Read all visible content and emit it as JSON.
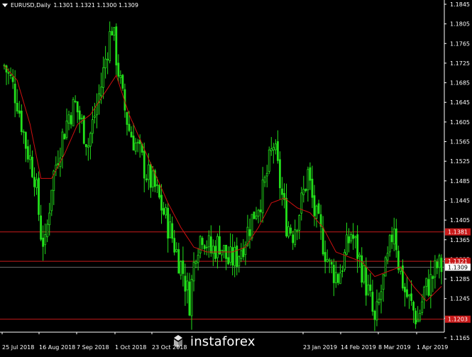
{
  "chart_header": {
    "symbol_timeframe": "EURUSD,Daily",
    "ohlc": "1.1301 1.1321 1.1300 1.1309"
  },
  "watermark": {
    "text": "instaforex"
  },
  "colors": {
    "background": "#000000",
    "candle": "#22e01b",
    "moving_average": "#d01010",
    "level_line": "#c81a1a",
    "price_tag_red": "#c81a1a",
    "price_tag_current": "#ffffff",
    "axis_text": "#ffffff"
  },
  "chart_data": {
    "type": "candlestick",
    "symbol": "EURUSD",
    "timeframe": "Daily",
    "ylim": [
      1.1165,
      1.1855
    ],
    "y_ticks": [
      "1.1845",
      "1.1805",
      "1.1765",
      "1.1725",
      "1.1685",
      "1.1645",
      "1.1605",
      "1.1565",
      "1.1525",
      "1.1485",
      "1.1445",
      "1.1405",
      "1.1365",
      "1.1325",
      "1.1285",
      "1.1245",
      "1.1205",
      "1.1165"
    ],
    "x_tick_labels": [
      "25 Jul 2018",
      "16 Aug 2018",
      "7 Sep 2018",
      "1 Oct 2018",
      "23 Oct 2018",
      "23 Jan 2019",
      "14 Feb 2019",
      "8 Mar 2019",
      "1 Apr 2019"
    ],
    "horizontal_levels": [
      {
        "label": "1.1381",
        "value": 1.1381
      },
      {
        "label": "1.1321",
        "value": 1.1321
      },
      {
        "label": "1.1203",
        "value": 1.1203
      }
    ],
    "current_price": {
      "label": "1.1309",
      "value": 1.1309
    },
    "close_path": [
      [
        0,
        1.172
      ],
      [
        3,
        1.169
      ],
      [
        6,
        1.165
      ],
      [
        10,
        1.156
      ],
      [
        14,
        1.15
      ],
      [
        17,
        1.138
      ],
      [
        19,
        1.135
      ],
      [
        22,
        1.148
      ],
      [
        26,
        1.156
      ],
      [
        30,
        1.162
      ],
      [
        33,
        1.164
      ],
      [
        36,
        1.16
      ],
      [
        39,
        1.156
      ],
      [
        42,
        1.162
      ],
      [
        45,
        1.168
      ],
      [
        48,
        1.176
      ],
      [
        50,
        1.18
      ],
      [
        52,
        1.174
      ],
      [
        55,
        1.165
      ],
      [
        58,
        1.159
      ],
      [
        62,
        1.155
      ],
      [
        66,
        1.15
      ],
      [
        70,
        1.147
      ],
      [
        74,
        1.142
      ],
      [
        78,
        1.137
      ],
      [
        80,
        1.134
      ],
      [
        83,
        1.13
      ],
      [
        86,
        1.124
      ],
      [
        89,
        1.135
      ],
      [
        92,
        1.138
      ],
      [
        96,
        1.134
      ],
      [
        100,
        1.136
      ],
      [
        104,
        1.132
      ],
      [
        108,
        1.133
      ],
      [
        112,
        1.137
      ],
      [
        116,
        1.142
      ],
      [
        120,
        1.146
      ],
      [
        123,
        1.152
      ],
      [
        125,
        1.156
      ],
      [
        128,
        1.148
      ],
      [
        131,
        1.14
      ],
      [
        134,
        1.138
      ],
      [
        138,
        1.144
      ],
      [
        141,
        1.15
      ],
      [
        144,
        1.142
      ],
      [
        148,
        1.136
      ],
      [
        151,
        1.131
      ],
      [
        155,
        1.129
      ],
      [
        158,
        1.133
      ],
      [
        161,
        1.138
      ],
      [
        164,
        1.134
      ],
      [
        167,
        1.129
      ],
      [
        170,
        1.124
      ],
      [
        172,
        1.119
      ],
      [
        175,
        1.126
      ],
      [
        178,
        1.132
      ],
      [
        181,
        1.14
      ],
      [
        183,
        1.132
      ],
      [
        186,
        1.126
      ],
      [
        189,
        1.123
      ],
      [
        192,
        1.12
      ],
      [
        195,
        1.126
      ],
      [
        198,
        1.128
      ],
      [
        201,
        1.131
      ],
      [
        203,
        1.1309
      ]
    ],
    "ma_path": [
      [
        0,
        1.172
      ],
      [
        6,
        1.169
      ],
      [
        12,
        1.16
      ],
      [
        17,
        1.149
      ],
      [
        22,
        1.149
      ],
      [
        28,
        1.154
      ],
      [
        34,
        1.16
      ],
      [
        40,
        1.162
      ],
      [
        46,
        1.166
      ],
      [
        52,
        1.17
      ],
      [
        58,
        1.162
      ],
      [
        64,
        1.156
      ],
      [
        70,
        1.15
      ],
      [
        76,
        1.144
      ],
      [
        82,
        1.139
      ],
      [
        88,
        1.135
      ],
      [
        94,
        1.134
      ],
      [
        100,
        1.134
      ],
      [
        106,
        1.134
      ],
      [
        112,
        1.135
      ],
      [
        118,
        1.139
      ],
      [
        124,
        1.144
      ],
      [
        130,
        1.145
      ],
      [
        136,
        1.143
      ],
      [
        142,
        1.142
      ],
      [
        148,
        1.139
      ],
      [
        154,
        1.134
      ],
      [
        160,
        1.133
      ],
      [
        166,
        1.132
      ],
      [
        172,
        1.129
      ],
      [
        178,
        1.13
      ],
      [
        184,
        1.131
      ],
      [
        190,
        1.127
      ],
      [
        196,
        1.124
      ],
      [
        203,
        1.127
      ]
    ]
  }
}
